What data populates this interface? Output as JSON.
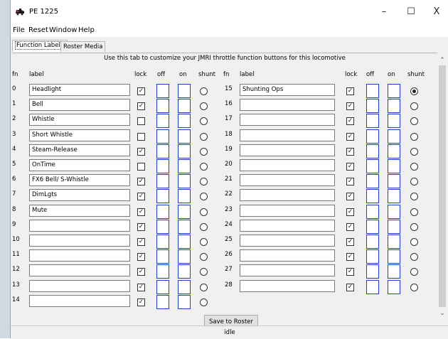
{
  "window": {
    "title": "PE 1225",
    "minimize": "–",
    "maximize": "☐",
    "close": "X"
  },
  "menu": [
    "File",
    "Reset",
    "Window",
    "Help"
  ],
  "tabs": [
    {
      "label": "Function Labels",
      "active": true
    },
    {
      "label": "Roster Media",
      "active": false
    }
  ],
  "instruction": "Use this tab to customize your JMRI throttle function buttons for this locomotive",
  "headers": {
    "fn": "fn",
    "label": "label",
    "lock": "lock",
    "off": "off",
    "on": "on",
    "shunt": "shunt"
  },
  "left_rows": [
    {
      "fn": "0",
      "label": "Headlight",
      "lock": true,
      "shunt": false
    },
    {
      "fn": "1",
      "label": "Bell",
      "lock": true,
      "shunt": false
    },
    {
      "fn": "2",
      "label": "Whistle",
      "lock": false,
      "shunt": false
    },
    {
      "fn": "3",
      "label": "Short Whistle",
      "lock": false,
      "shunt": false
    },
    {
      "fn": "4",
      "label": "Steam-Release",
      "lock": true,
      "shunt": false
    },
    {
      "fn": "5",
      "label": "OnTime",
      "lock": false,
      "shunt": false
    },
    {
      "fn": "6",
      "label": "FX6 Bell/ S-Whistle",
      "lock": true,
      "shunt": false
    },
    {
      "fn": "7",
      "label": "DimLgts",
      "lock": true,
      "shunt": false
    },
    {
      "fn": "8",
      "label": "Mute",
      "lock": true,
      "shunt": false
    },
    {
      "fn": "9",
      "label": "",
      "lock": true,
      "shunt": false
    },
    {
      "fn": "10",
      "label": "",
      "lock": true,
      "shunt": false
    },
    {
      "fn": "11",
      "label": "",
      "lock": true,
      "shunt": false
    },
    {
      "fn": "12",
      "label": "",
      "lock": true,
      "shunt": false
    },
    {
      "fn": "13",
      "label": "",
      "lock": true,
      "shunt": false
    },
    {
      "fn": "14",
      "label": "",
      "lock": true,
      "shunt": false
    }
  ],
  "right_rows": [
    {
      "fn": "15",
      "label": "Shunting Ops",
      "lock": true,
      "shunt": true
    },
    {
      "fn": "16",
      "label": "",
      "lock": true,
      "shunt": false
    },
    {
      "fn": "17",
      "label": "",
      "lock": true,
      "shunt": false
    },
    {
      "fn": "18",
      "label": "",
      "lock": true,
      "shunt": false
    },
    {
      "fn": "19",
      "label": "",
      "lock": true,
      "shunt": false
    },
    {
      "fn": "20",
      "label": "",
      "lock": true,
      "shunt": false
    },
    {
      "fn": "21",
      "label": "",
      "lock": true,
      "shunt": false
    },
    {
      "fn": "22",
      "label": "",
      "lock": true,
      "shunt": false
    },
    {
      "fn": "23",
      "label": "",
      "lock": true,
      "shunt": false
    },
    {
      "fn": "24",
      "label": "",
      "lock": true,
      "shunt": false
    },
    {
      "fn": "25",
      "label": "",
      "lock": true,
      "shunt": false
    },
    {
      "fn": "26",
      "label": "",
      "lock": true,
      "shunt": false
    },
    {
      "fn": "27",
      "label": "",
      "lock": true,
      "shunt": false
    },
    {
      "fn": "28",
      "label": "",
      "lock": true,
      "shunt": false
    }
  ],
  "save_label": "Save to Roster",
  "status": "idle",
  "icons": {
    "app": "locomotive-icon",
    "check": "✓"
  },
  "colors": {
    "icon_border": "#1e3fd8"
  }
}
